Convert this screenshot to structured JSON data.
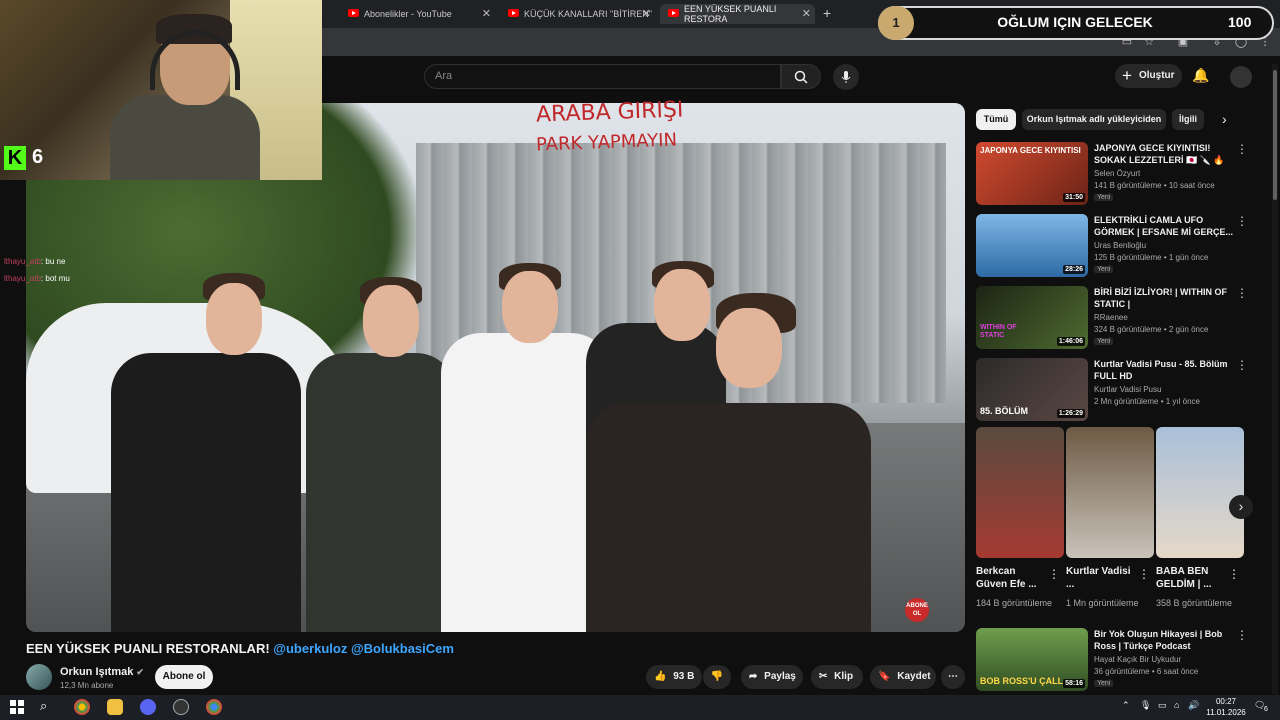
{
  "browser": {
    "tabs": [
      {
        "title": "Abonelikler - YouTube"
      },
      {
        "title": "KÜÇÜK KANALLARI \"BİTİREN\""
      },
      {
        "title": "EEN YÜKSEK PUANLI RESTORA"
      }
    ]
  },
  "goal": {
    "level": "1",
    "title": "OĞLUM IÇIN GELECEK",
    "count": "100"
  },
  "kick": {
    "viewer_count": "6"
  },
  "chat": [
    {
      "user": "lthayu_atb",
      "text": ": bu ne"
    },
    {
      "user": "lthayu_atb",
      "text": ": bot mu"
    }
  ],
  "header": {
    "search_placeholder": "Ara",
    "create_label": "Oluştur"
  },
  "video": {
    "graffiti_line1": "ARABA GIRIŞI",
    "graffiti_line2": "PARK YAPMAYIN",
    "badge": "ABONE OL",
    "title_main": "EEN YÜKSEK PUANLI RESTORANLAR! ",
    "title_tags": "@uberkuloz @BolukbasiCem",
    "channel": "Orkun Işıtmak",
    "subscribers": "12,3 Mn abone",
    "subscribe_label": "Abone ol",
    "likes": "93 B",
    "share_label": "Paylaş",
    "clip_label": "Klip",
    "save_label": "Kaydet"
  },
  "sidebar": {
    "chips": [
      "Tümü",
      "Orkun Işıtmak adlı yükleyiciden",
      "İlgili"
    ],
    "related": [
      {
        "title": "JAPONYA GECE KIYINTISI! SOKAK LEZZETLERİ 🇯🇵 🔪 🔥",
        "channel": "Selen Özyurt",
        "meta": "141 B görüntüleme • 10 saat önce",
        "badge": "Yeni",
        "duration": "31:50",
        "thumb_text": "JAPONYA GECE KIYINTISI",
        "color": "#b8352a"
      },
      {
        "title": "ELEKTRİKLİ CAMLA UFO GÖRMEK | EFSANE Mİ GERÇE...",
        "channel": "Uras Benlioğlu",
        "meta": "125 B görüntüleme • 1 gün önce",
        "badge": "Yeni",
        "duration": "28:26",
        "thumb_text": "",
        "color": "#3f86c9"
      },
      {
        "title": "BİRİ BİZİ İZLİYOR! | WITHIN OF STATIC |",
        "channel": "RRaenee",
        "meta": "324 B görüntüleme • 2 gün önce",
        "badge": "Yeni",
        "duration": "1:46:06",
        "thumb_text": "WITHIN OF STATIC",
        "color": "#2e3a22"
      },
      {
        "title": "Kurtlar Vadisi Pusu - 85. Bölüm FULL HD",
        "channel": "Kurtlar Vadisi Pusu",
        "meta": "2 Mn görüntüleme • 1 yıl önce",
        "badge": "",
        "duration": "1:26:29",
        "thumb_text": "85. BÖLÜM",
        "color": "#3b3230"
      }
    ],
    "shorts": [
      {
        "title": "Berkcan Güven Efe ...",
        "views": "184 B görüntüleme",
        "color": "#7a5a4a"
      },
      {
        "title": "Kurtlar Vadisi ...",
        "views": "1 Mn görüntüleme",
        "color": "#5a4a3a"
      },
      {
        "title": "BABA BEN GELDİM | ...",
        "views": "358 B görüntüleme",
        "color": "#a8b6c4"
      }
    ],
    "bottom": {
      "title": "Bir Yok Oluşun Hikayesi | Bob Ross | Türkçe Podcast",
      "channel": "Hayat Kaçık Bir Uykudur",
      "meta": "36 görüntüleme • 6 saat önce",
      "badge": "Yeni",
      "duration": "58:16",
      "thumb_text": "BOB ROSS'U ÇALL"
    }
  },
  "taskbar": {
    "time": "00:27",
    "date": "11.01.2026",
    "notif": "6"
  }
}
